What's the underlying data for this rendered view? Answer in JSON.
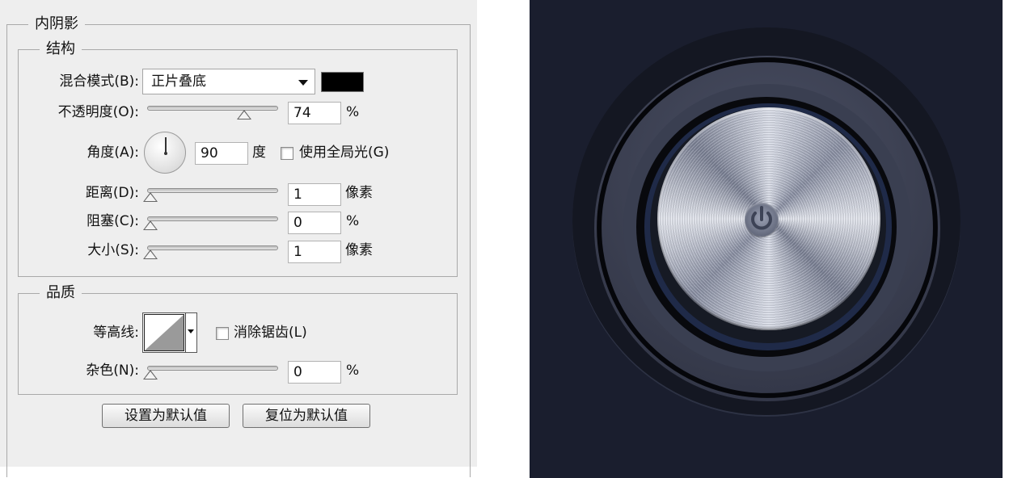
{
  "dialog": {
    "title": "内阴影",
    "structure": {
      "title": "结构",
      "blend_mode": {
        "label": "混合模式(B):",
        "value": "正片叠底",
        "color": "#000000"
      },
      "opacity": {
        "label": "不透明度(O):",
        "value": "74",
        "unit": "%",
        "level": 0.74
      },
      "angle": {
        "label": "角度(A):",
        "value": "90",
        "unit": "度",
        "use_global_light": "使用全局光(G)",
        "use_global_light_checked": false
      },
      "distance": {
        "label": "距离(D):",
        "value": "1",
        "unit": "像素",
        "level": 0.0
      },
      "choke": {
        "label": "阻塞(C):",
        "value": "0",
        "unit": "%",
        "level": 0.0
      },
      "size": {
        "label": "大小(S):",
        "value": "1",
        "unit": "像素",
        "level": 0.0
      }
    },
    "quality": {
      "title": "品质",
      "contour": {
        "label": "等高线:",
        "anti_alias": "消除锯齿(L)",
        "anti_alias_checked": false
      },
      "noise": {
        "label": "杂色(N):",
        "value": "0",
        "unit": "%",
        "level": 0.0
      }
    },
    "buttons": {
      "set_default": "设置为默认值",
      "reset_default": "复位为默认值"
    }
  },
  "preview": {
    "background": "#1a1e2e",
    "icon": "power-icon"
  }
}
